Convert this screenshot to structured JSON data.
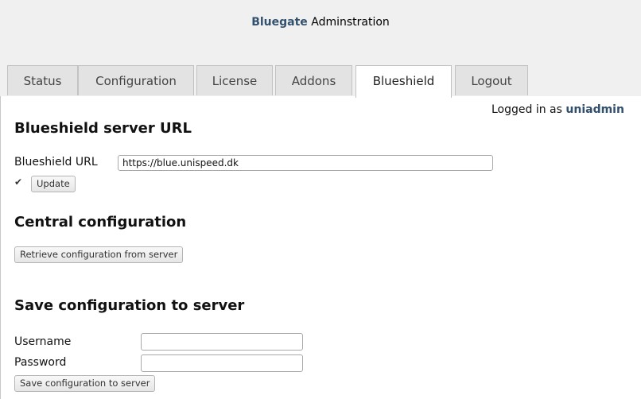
{
  "header": {
    "brand": "Bluegate",
    "title_rest": " Adminstration"
  },
  "tabs": [
    {
      "label": "Status",
      "active": false
    },
    {
      "label": "Configuration",
      "active": false
    },
    {
      "label": "License",
      "active": false
    },
    {
      "label": "Addons",
      "active": false
    },
    {
      "label": "Blueshield",
      "active": true
    },
    {
      "label": "Logout",
      "active": false
    }
  ],
  "session": {
    "prefix": "Logged in as ",
    "user": "uniadmin"
  },
  "blueshield_url_section": {
    "heading": "Blueshield server URL",
    "url_label": "Blueshield URL",
    "url_value": "https://blue.unispeed.dk",
    "check_icon": "check-icon",
    "update_button": "Update"
  },
  "central_config_section": {
    "heading": "Central configuration",
    "retrieve_button": "Retrieve configuration from server"
  },
  "save_config_section": {
    "heading": "Save configuration to server",
    "username_label": "Username",
    "username_value": "",
    "password_label": "Password",
    "password_value": "",
    "save_button": "Save configuration to server"
  }
}
